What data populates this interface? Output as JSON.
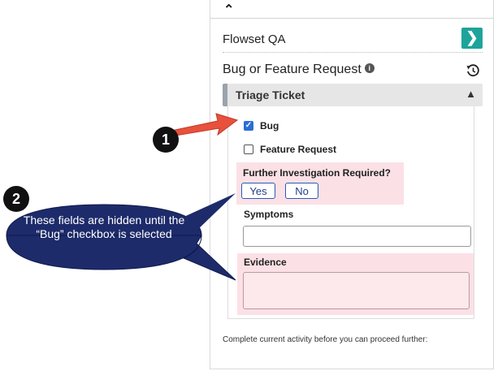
{
  "panel": {
    "flow_title": "Flowset QA",
    "flow_icon": "chevron-right-icon",
    "form_title": "Bug or Feature Request",
    "info_icon_glyph": "i",
    "collapse_caret": "⌃",
    "section": {
      "title": "Triage Ticket",
      "caret": "▲",
      "bug_label": "Bug",
      "bug_checked": true,
      "feature_label": "Feature Request",
      "feature_checked": false,
      "further_label": "Further Investigation Required?",
      "yes_label": "Yes",
      "no_label": "No",
      "symptoms_label": "Symptoms",
      "symptoms_value": "",
      "evidence_label": "Evidence",
      "evidence_value": ""
    },
    "footer_note": "Complete current activity before you can proceed further:"
  },
  "callouts": {
    "badge1": "1",
    "badge2": "2",
    "bubble_text": "These fields are hidden until the “Bug” checkbox is selected",
    "arrow_color": "#e8513c",
    "bubble_color": "#1d2b6b"
  },
  "colors": {
    "accent": "#1ea39a",
    "highlight_pink": "#fbe1e6",
    "button_blue": "#2a5ab5"
  }
}
